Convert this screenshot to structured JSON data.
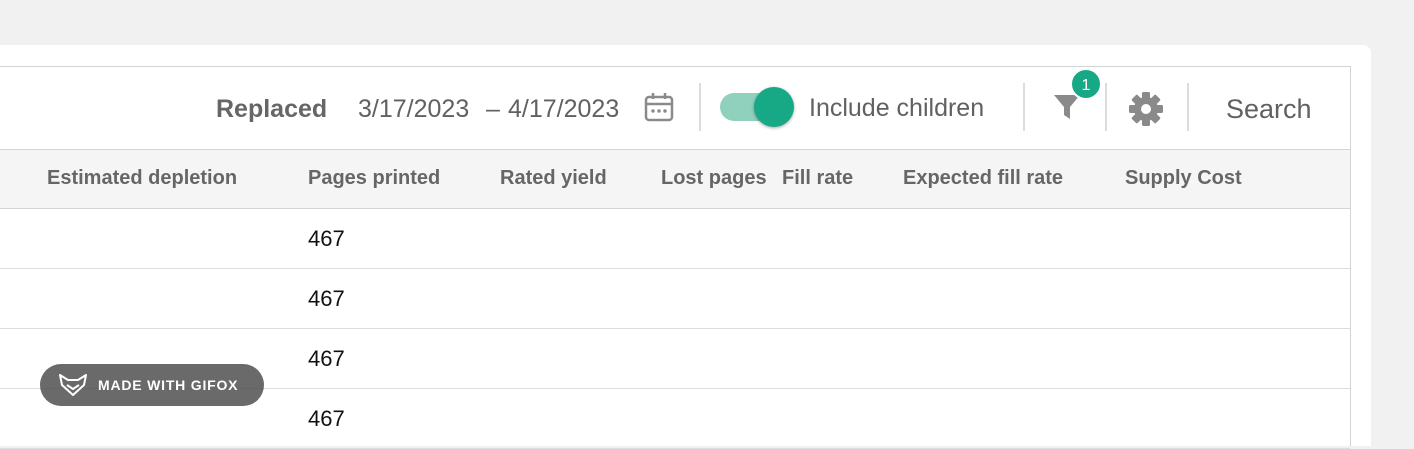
{
  "toolbar": {
    "label": "Replaced",
    "date_start": "3/17/2023",
    "date_separator": "–",
    "date_end": "4/17/2023",
    "include_children_label": "Include children",
    "include_children_on": true,
    "filter_count": "1",
    "search_label": "Search"
  },
  "table": {
    "columns": [
      "Estimated depletion",
      "Pages printed",
      "Rated yield",
      "Lost pages",
      "Fill rate",
      "Expected fill rate",
      "Supply Cost"
    ],
    "rows": [
      {
        "pages_printed": "467"
      },
      {
        "pages_printed": "467"
      },
      {
        "pages_printed": "467"
      },
      {
        "pages_printed": "467"
      }
    ]
  },
  "watermark": {
    "text": "MADE WITH GIFOX"
  },
  "colors": {
    "accent": "#17a886",
    "accent_light": "#8fd1bd",
    "text": "#616161",
    "header_bg": "#f5f5f5"
  },
  "icons": [
    "calendar-icon",
    "filter-icon",
    "gear-icon",
    "fox-icon"
  ]
}
